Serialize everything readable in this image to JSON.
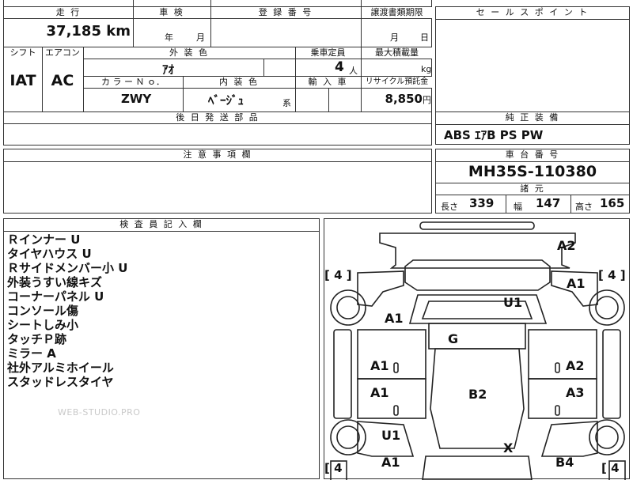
{
  "sheet": {
    "mileage_header": "走 行",
    "mileage_value": "37,185",
    "mileage_unit": "km",
    "inspection_header": "車 検",
    "inspection_year": "年",
    "inspection_month": "月",
    "registration_header": "登 録 番 号",
    "transfer_header": "譲渡書類期限",
    "transfer_month": "月",
    "transfer_day": "日",
    "shift_header": "シフト",
    "shift_value": "IAT",
    "ac_header": "エアコン",
    "ac_value": "AC",
    "exterior_color_header": "外 装 色",
    "exterior_color_value": "ｱｵ",
    "capacity_header": "乗車定員",
    "capacity_value": "4",
    "capacity_unit": "人",
    "load_header": "最大積載量",
    "load_unit": "kg",
    "color_no_header": "カ ラ ー Ｎ ｏ．",
    "color_no_value": "ZWY",
    "interior_color_header": "内 装 色",
    "interior_color_value": "ﾍﾞｰｼﾞｭ",
    "interior_suffix": "系",
    "import_header": "輸 入 車",
    "recycle_header": "リサイクル預託金",
    "recycle_value": "8,850",
    "recycle_unit": "円",
    "later_parts_header": "後 日 発 送 部 品",
    "notes_header": "注 意 事 項 欄",
    "sales_point_header": "セ ー ル ス ポ イ ン ト",
    "equipment_header": "純 正 装 備",
    "equipment_value": "ABS ｴｱB PS PW",
    "chassis_header": "車 台 番 号",
    "chassis_value": "MH35S-110380",
    "specs_header": "諸 元",
    "length_label": "長さ",
    "length_value": "339",
    "width_label": "幅",
    "width_value": "147",
    "height_label": "高さ",
    "height_value": "165",
    "inspector_header": "検 査 員 記 入 欄",
    "inspector_notes": [
      "Ｒインナー U",
      "タイヤハウス U",
      "Ｒサイドメンバー小 U",
      "外装うすい線キズ",
      "コーナーパネル U",
      "コンソール傷",
      "シートしみ小",
      "タッチＰ跡",
      "ミラー A",
      "社外アルミホイール",
      "スタッドレスタイヤ"
    ],
    "watermark": "WEB-STUDIO.PRO"
  },
  "diagram": {
    "marks": {
      "a2_top": "A2",
      "a1_right_top": "A1",
      "u1_roof": "U1",
      "a1_left_front": "A1",
      "g_windshield": "G",
      "a1_left_door1": "A1",
      "a2_right_door1": "A2",
      "a1_left_door2": "A1",
      "b2_center": "B2",
      "a3_right_door2": "A3",
      "u1_left_rear": "U1",
      "x_rear": "X",
      "a1_left_bottom": "A1",
      "b4_right_bottom": "B4"
    },
    "tire_marks": {
      "tl": "[ 4 ]",
      "tr": "[ 4 ]",
      "bl": "[ 4",
      "br": "[ 4"
    }
  }
}
